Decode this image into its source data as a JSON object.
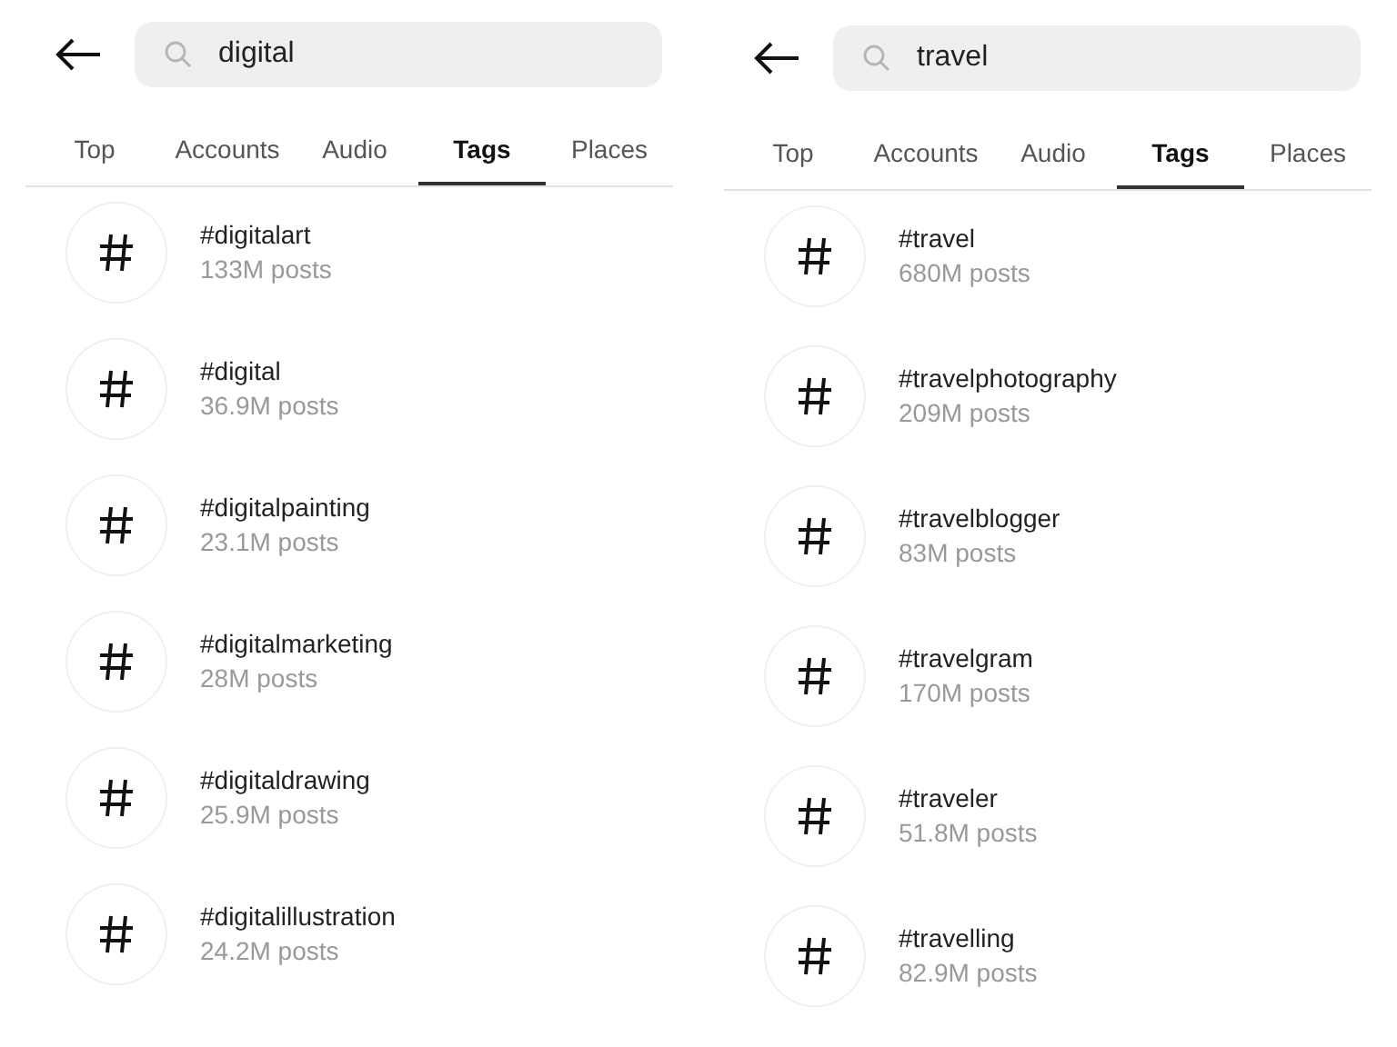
{
  "screens": [
    {
      "search": {
        "value": "digital"
      },
      "tabs": [
        {
          "label": "Top",
          "selected": false
        },
        {
          "label": "Accounts",
          "selected": false
        },
        {
          "label": "Audio",
          "selected": false
        },
        {
          "label": "Tags",
          "selected": true
        },
        {
          "label": "Places",
          "selected": false
        }
      ],
      "results": [
        {
          "tag": "#digitalart",
          "posts": "133M posts"
        },
        {
          "tag": "#digital",
          "posts": "36.9M posts"
        },
        {
          "tag": "#digitalpainting",
          "posts": "23.1M posts"
        },
        {
          "tag": "#digitalmarketing",
          "posts": "28M posts"
        },
        {
          "tag": "#digitaldrawing",
          "posts": "25.9M posts"
        },
        {
          "tag": "#digitalillustration",
          "posts": "24.2M posts"
        }
      ]
    },
    {
      "search": {
        "value": "travel"
      },
      "tabs": [
        {
          "label": "Top",
          "selected": false
        },
        {
          "label": "Accounts",
          "selected": false
        },
        {
          "label": "Audio",
          "selected": false
        },
        {
          "label": "Tags",
          "selected": true
        },
        {
          "label": "Places",
          "selected": false
        }
      ],
      "results": [
        {
          "tag": "#travel",
          "posts": "680M posts"
        },
        {
          "tag": "#travelphotography",
          "posts": "209M posts"
        },
        {
          "tag": "#travelblogger",
          "posts": "83M posts"
        },
        {
          "tag": "#travelgram",
          "posts": "170M posts"
        },
        {
          "tag": "#traveler",
          "posts": "51.8M posts"
        },
        {
          "tag": "#travelling",
          "posts": "82.9M posts"
        }
      ]
    }
  ]
}
